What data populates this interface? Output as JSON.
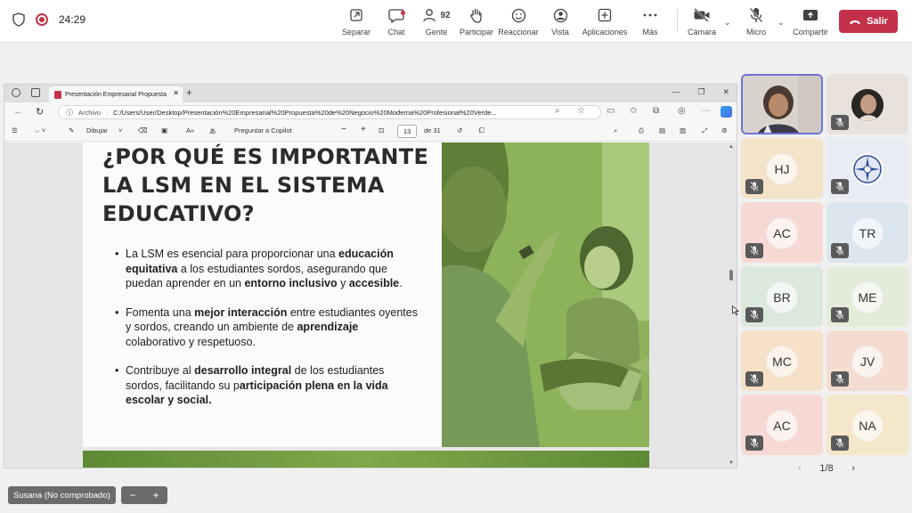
{
  "meeting": {
    "timer": "24:29",
    "toolbar": [
      {
        "label": "Separar",
        "icon": "pop-out-icon"
      },
      {
        "label": "Chat",
        "icon": "chat-icon"
      },
      {
        "label": "Gente",
        "icon": "people-icon",
        "count": "92"
      },
      {
        "label": "Participar",
        "icon": "raise-hand-icon"
      },
      {
        "label": "Reaccionar",
        "icon": "smiley-icon"
      },
      {
        "label": "Vista",
        "icon": "view-icon"
      },
      {
        "label": "Aplicaciones",
        "icon": "apps-plus-icon"
      },
      {
        "label": "Más",
        "icon": "more-icon"
      },
      {
        "label": "Cámara",
        "icon": "camera-off-icon"
      },
      {
        "label": "Micro",
        "icon": "mic-off-icon"
      },
      {
        "label": "Compartir",
        "icon": "share-icon"
      }
    ],
    "leave_label": "Salir",
    "accent": "#c4314b"
  },
  "browser": {
    "tab_title": "Presentación Empresarial Propuesta",
    "url_prefix": "Archivo",
    "url": "C:/Users/User/Desktop/Presentación%20Empresarial%20Propuesta%20de%20Negocio%20Moderna%20Profesional%20Verde...",
    "pdf_toolbar": {
      "draw_label": "Dibujar",
      "copilot_label": "Preguntar a Copilot",
      "page_current": "13",
      "page_total": "de 31"
    }
  },
  "slide": {
    "title_lines": [
      "¿POR QUÉ ES IMPORTANTE",
      "LA LSM EN EL SISTEMA",
      "EDUCATIVO?"
    ],
    "bullets": [
      {
        "parts": [
          {
            "t": "La LSM es esencial para proporcionar una ",
            "b": false
          },
          {
            "t": "educación equitativa",
            "b": true
          },
          {
            "t": " a los estudiantes sordos, asegurando que puedan aprender en un ",
            "b": false
          },
          {
            "t": "entorno inclusivo",
            "b": true
          },
          {
            "t": " y ",
            "b": false
          },
          {
            "t": "accesible",
            "b": true
          },
          {
            "t": ".",
            "b": false
          }
        ]
      },
      {
        "parts": [
          {
            "t": "Fomenta una ",
            "b": false
          },
          {
            "t": "mejor interacción",
            "b": true
          },
          {
            "t": " entre estudiantes oyentes y sordos, creando un ambiente de ",
            "b": false
          },
          {
            "t": "aprendizaje",
            "b": true
          },
          {
            "t": " colaborativo y respetuoso.",
            "b": false
          }
        ]
      },
      {
        "parts": [
          {
            "t": "Contribuye al ",
            "b": false
          },
          {
            "t": "desarrollo integral",
            "b": true
          },
          {
            "t": " de los estudiantes sordos, facilitando su p",
            "b": false
          },
          {
            "t": "articipación plena en la vida escolar y social.",
            "b": true
          }
        ]
      }
    ]
  },
  "presenter": {
    "name": "Susana (No comprobado)"
  },
  "participants": [
    {
      "initials": "",
      "type": "video",
      "color": "#d8d2cc"
    },
    {
      "initials": "",
      "type": "photo",
      "color": "#e9e2dc"
    },
    {
      "initials": "HJ",
      "color": "#f4e3c8"
    },
    {
      "initials": "",
      "type": "logo",
      "color": "#e8ecf4"
    },
    {
      "initials": "AC",
      "color": "#f7d9d4"
    },
    {
      "initials": "TR",
      "color": "#dbe6ef"
    },
    {
      "initials": "BR",
      "color": "#dbe9dd"
    },
    {
      "initials": "ME",
      "color": "#e3ecd8"
    },
    {
      "initials": "MC",
      "color": "#f6e0c7"
    },
    {
      "initials": "JV",
      "color": "#f4ddd0"
    },
    {
      "initials": "AC",
      "color": "#f7d9d4"
    },
    {
      "initials": "NA",
      "color": "#f5e7c9"
    }
  ],
  "pager": "1/8"
}
